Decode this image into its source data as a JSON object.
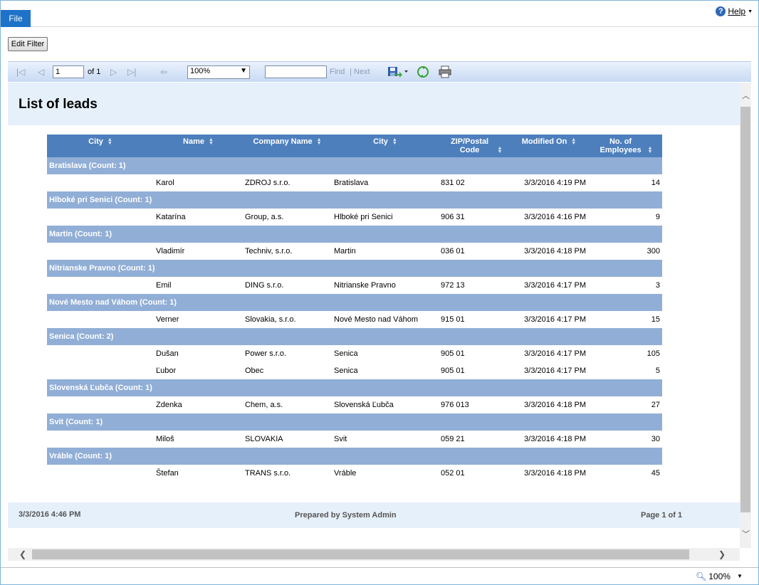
{
  "menu": {
    "file": "File",
    "help": "Help"
  },
  "filter": {
    "edit_label": "Edit Filter"
  },
  "toolbar": {
    "page_value": "1",
    "of_label": "of 1",
    "zoom": "100%",
    "find": "Find",
    "next": "Next",
    "separator": "|"
  },
  "report": {
    "title": "List of leads",
    "columns": [
      "City",
      "Name",
      "Company Name",
      "City",
      "ZIP/Postal Code",
      "Modified On",
      "No. of Employees"
    ],
    "groups": [
      {
        "label": "Bratislava (Count: 1)",
        "rows": [
          {
            "name": "Karol",
            "company": "ZDROJ s.r.o.",
            "city": "Bratislava",
            "zip": "831 02",
            "modified": "3/3/2016 4:19 PM",
            "employees": "14"
          }
        ]
      },
      {
        "label": "Hlboké pri Senici (Count: 1)",
        "rows": [
          {
            "name": "Katarína",
            "company": "Group, a.s.",
            "city": "Hlboké pri Senici",
            "zip": "906 31",
            "modified": "3/3/2016 4:16 PM",
            "employees": "9"
          }
        ]
      },
      {
        "label": "Martin (Count: 1)",
        "rows": [
          {
            "name": "Vladimír",
            "company": "Techniv, s.r.o.",
            "city": "Martin",
            "zip": "036 01",
            "modified": "3/3/2016 4:18 PM",
            "employees": "300"
          }
        ]
      },
      {
        "label": "Nitrianske Pravno (Count: 1)",
        "rows": [
          {
            "name": "Emil",
            "company": "DING s.r.o.",
            "city": "Nitrianske Pravno",
            "zip": "972 13",
            "modified": "3/3/2016 4:17 PM",
            "employees": "3"
          }
        ]
      },
      {
        "label": "Nové Mesto nad Váhom (Count: 1)",
        "rows": [
          {
            "name": "Verner",
            "company": "Slovakia, s.r.o.",
            "city": "Nové Mesto nad Váhom",
            "zip": "915 01",
            "modified": "3/3/2016 4:17 PM",
            "employees": "15"
          }
        ]
      },
      {
        "label": "Senica (Count: 2)",
        "rows": [
          {
            "name": "Dušan",
            "company": "Power s.r.o.",
            "city": "Senica",
            "zip": "905 01",
            "modified": "3/3/2016 4:17 PM",
            "employees": "105"
          },
          {
            "name": "Ľubor",
            "company": "Obec",
            "city": "Senica",
            "zip": "905 01",
            "modified": "3/3/2016 4:17 PM",
            "employees": "5"
          }
        ]
      },
      {
        "label": "Slovenská Ľubča (Count: 1)",
        "rows": [
          {
            "name": "Zdenka",
            "company": "Chem, a.s.",
            "city": "Slovenská Ľubča",
            "zip": "976 013",
            "modified": "3/3/2016 4:18 PM",
            "employees": "27"
          }
        ]
      },
      {
        "label": "Svit (Count: 1)",
        "rows": [
          {
            "name": "Miloš",
            "company": "SLOVAKIA",
            "city": "Svit",
            "zip": "059 21",
            "modified": "3/3/2016 4:18 PM",
            "employees": "30"
          }
        ]
      },
      {
        "label": "Vráble (Count: 1)",
        "rows": [
          {
            "name": "Štefan",
            "company": "TRANS s.r.o.",
            "city": "Vráble",
            "zip": "052 01",
            "modified": "3/3/2016 4:18 PM",
            "employees": "45"
          }
        ]
      }
    ],
    "footer": {
      "date": "3/3/2016 4:46 PM",
      "prepared": "Prepared by System Admin",
      "page": "Page 1 of 1"
    }
  },
  "status": {
    "zoom": "100%"
  },
  "colors": {
    "accent": "#1e73c8",
    "header": "#4d7fbd",
    "group": "#91aed6",
    "band": "#e6f0fb"
  }
}
